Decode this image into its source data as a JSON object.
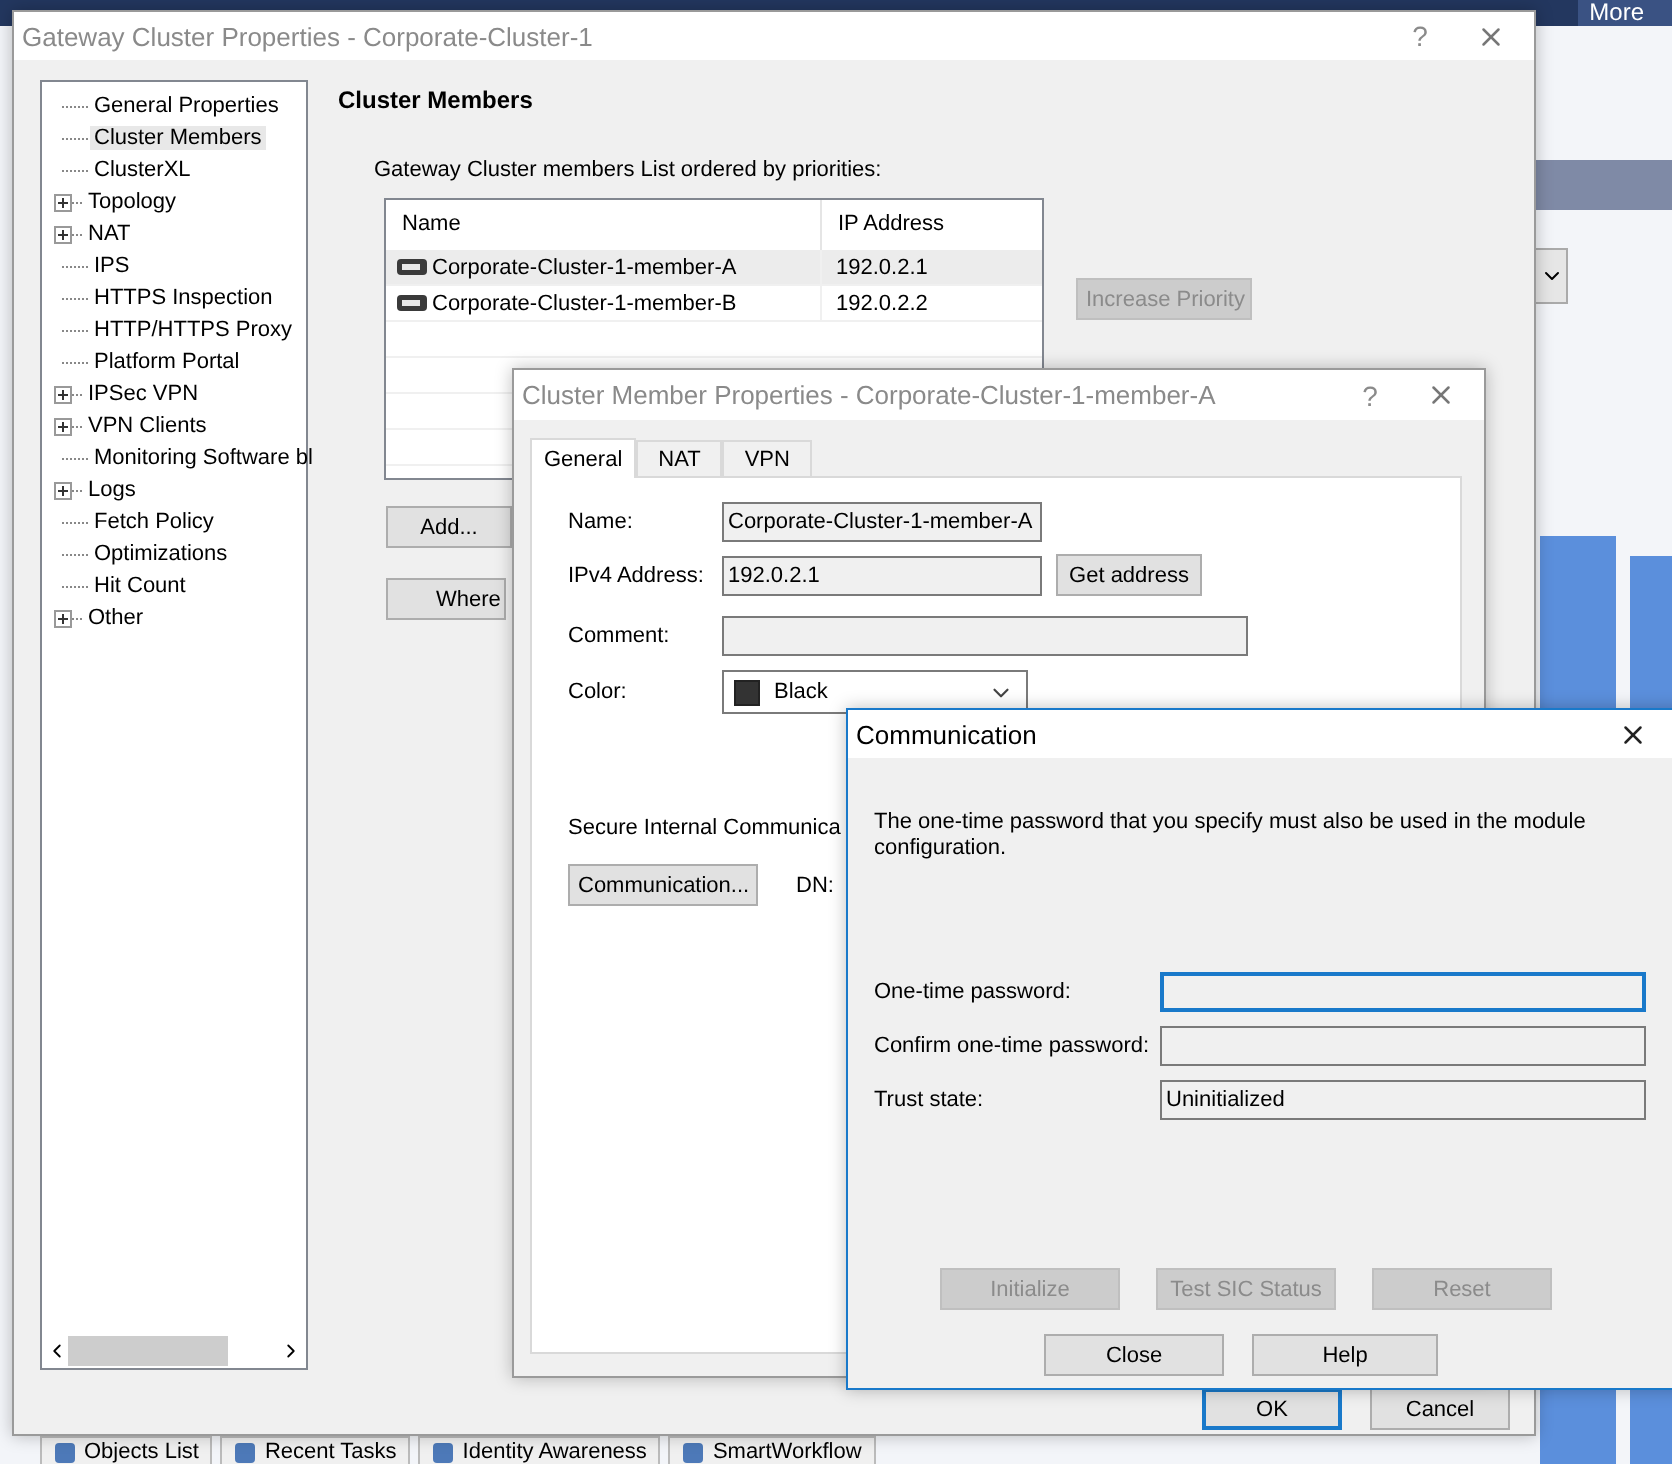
{
  "app_toolbar": {
    "more": "More"
  },
  "bottom_tabs": [
    {
      "label": "Objects List"
    },
    {
      "label": "Recent Tasks"
    },
    {
      "label": "Identity Awareness"
    },
    {
      "label": "SmartWorkflow"
    }
  ],
  "gateway_dialog": {
    "title": "Gateway Cluster Properties - Corporate-Cluster-1",
    "help_glyph": "?",
    "tree": [
      {
        "label": "General Properties",
        "expandable": false,
        "selected": false
      },
      {
        "label": "Cluster Members",
        "expandable": false,
        "selected": true
      },
      {
        "label": "ClusterXL",
        "expandable": false,
        "selected": false
      },
      {
        "label": "Topology",
        "expandable": true,
        "selected": false
      },
      {
        "label": "NAT",
        "expandable": true,
        "selected": false
      },
      {
        "label": "IPS",
        "expandable": false,
        "selected": false
      },
      {
        "label": "HTTPS Inspection",
        "expandable": false,
        "selected": false
      },
      {
        "label": "HTTP/HTTPS Proxy",
        "expandable": false,
        "selected": false
      },
      {
        "label": "Platform Portal",
        "expandable": false,
        "selected": false
      },
      {
        "label": "IPSec VPN",
        "expandable": true,
        "selected": false
      },
      {
        "label": "VPN Clients",
        "expandable": true,
        "selected": false
      },
      {
        "label": "Monitoring Software bl",
        "expandable": false,
        "selected": false
      },
      {
        "label": "Logs",
        "expandable": true,
        "selected": false
      },
      {
        "label": "Fetch Policy",
        "expandable": false,
        "selected": false
      },
      {
        "label": "Optimizations",
        "expandable": false,
        "selected": false
      },
      {
        "label": "Hit Count",
        "expandable": false,
        "selected": false
      },
      {
        "label": "Other",
        "expandable": true,
        "selected": false
      }
    ],
    "heading": "Cluster Members",
    "list_caption": "Gateway Cluster members List ordered by priorities:",
    "table": {
      "columns": [
        "Name",
        "IP Address"
      ],
      "rows": [
        {
          "name": "Corporate-Cluster-1-member-A",
          "ip": "192.0.2.1",
          "selected": true
        },
        {
          "name": "Corporate-Cluster-1-member-B",
          "ip": "192.0.2.2",
          "selected": false
        }
      ]
    },
    "list_buttons": [
      {
        "label": "Add...",
        "disabled": false
      },
      {
        "label": "Where",
        "disabled": false
      }
    ],
    "increase_priority": {
      "label": "Increase Priority",
      "disabled": true
    },
    "footer_buttons": [
      {
        "label": "OK",
        "default": true
      },
      {
        "label": "Cancel",
        "default": false
      }
    ]
  },
  "member_dialog": {
    "title": "Cluster Member Properties - Corporate-Cluster-1-member-A",
    "help_glyph": "?",
    "tabs": [
      {
        "label": "General",
        "selected": true
      },
      {
        "label": "NAT",
        "selected": false
      },
      {
        "label": "VPN",
        "selected": false
      }
    ],
    "fields": [
      {
        "label": "Name:",
        "value": "Corporate-Cluster-1-member-A",
        "kind": "short"
      },
      {
        "label": "IPv4 Address:",
        "value": "192.0.2.1",
        "kind": "short",
        "button": "Get address"
      },
      {
        "label": "Comment:",
        "kind": "long"
      }
    ],
    "color": {
      "label": "Color:",
      "value": "Black",
      "color": "#333333"
    },
    "sic_label": "Secure Internal Communica",
    "communication_button": "Communication...",
    "dn_label": "DN:"
  },
  "communication_dialog": {
    "title": "Communication",
    "message": "The one-time password that you specify must also be used in the module configuration.",
    "fields": [
      {
        "label": "One-time password:",
        "kind": "input",
        "focused": true
      },
      {
        "label": "Confirm one-time password:",
        "kind": "input",
        "focused": false
      },
      {
        "label": "Trust state:",
        "kind": "readonly",
        "value": "Uninitialized",
        "focused": false
      }
    ],
    "action_buttons": [
      {
        "label": "Initialize",
        "disabled": true
      },
      {
        "label": "Test SIC Status",
        "disabled": true
      },
      {
        "label": "Reset",
        "disabled": true
      }
    ],
    "buttons": [
      {
        "label": "Close",
        "disabled": false
      },
      {
        "label": "Help",
        "disabled": false
      }
    ]
  }
}
